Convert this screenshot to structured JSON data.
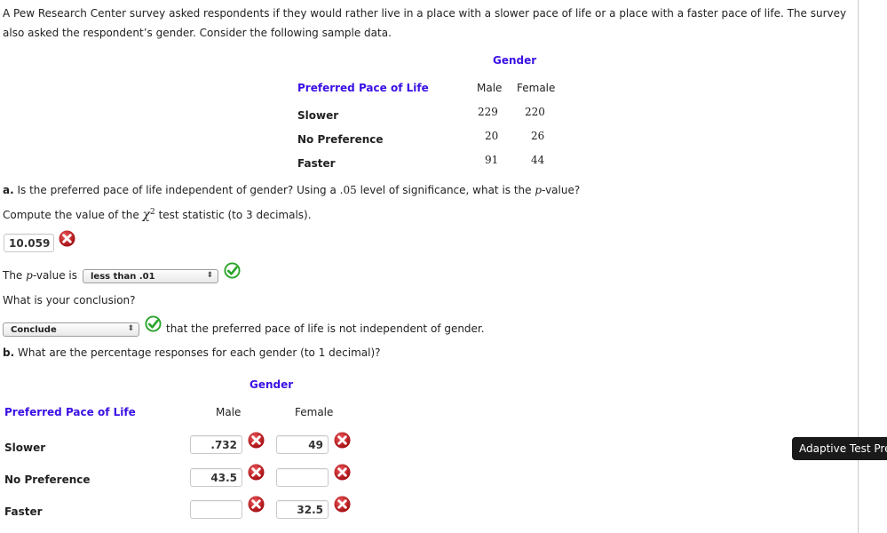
{
  "intro_text": "A Pew Research Center survey asked respondents if they would rather live in a place with a slower pace of life or a place with a faster pace of life. The survey also asked the respondent’s gender. Consider the following sample data.",
  "data_table": {
    "group_header": "Gender",
    "row_header": "Preferred Pace of Life",
    "columns": [
      "Male",
      "Female"
    ],
    "rows": [
      {
        "label": "Slower",
        "values": [
          "229",
          "220"
        ]
      },
      {
        "label": "No Preference",
        "values": [
          "20",
          "26"
        ]
      },
      {
        "label": "Faster",
        "values": [
          "91",
          "44"
        ]
      }
    ]
  },
  "part_a": {
    "prefix": "a.",
    "question_pre": " Is the preferred pace of life independent of gender? Using a ",
    "significance": ".05",
    "question_mid": " level of significance, what is the ",
    "p_symbol": "p",
    "question_post": "-value?",
    "compute_pre": "Compute the value of the ",
    "chi_symbol": "χ",
    "chi_exp": "2",
    "compute_post": " test statistic (to 3 decimals).",
    "chi_value": "10.059",
    "chi_status": "incorrect",
    "pvalue_pre": "The ",
    "pvalue_p": "p",
    "pvalue_post": "-value is",
    "pvalue_selected": "less than .01",
    "pvalue_status": "correct",
    "conclusion_question": "What is your conclusion?",
    "conclusion_selected": "Conclude",
    "conclusion_status": "correct",
    "conclusion_text": "that the preferred pace of life is not independent of gender."
  },
  "part_b": {
    "prefix": "b.",
    "question": " What are the percentage responses for each gender (to 1 decimal)?",
    "group_header": "Gender",
    "row_header": "Preferred Pace of Life",
    "columns": [
      "Male",
      "Female"
    ],
    "rows": [
      {
        "label": "Slower",
        "male": ".732",
        "female": "49",
        "male_status": "incorrect",
        "female_status": "incorrect"
      },
      {
        "label": "No Preference",
        "male": "43.5",
        "female": "",
        "male_status": "incorrect",
        "female_status": "incorrect"
      },
      {
        "label": "Faster",
        "male": "",
        "female": "32.5",
        "male_status": "incorrect",
        "female_status": "incorrect"
      }
    ]
  },
  "tooltip": "Adaptive Test Prep",
  "colors": {
    "header_blue": "#3a10e5",
    "correct_green": "#2aa52a",
    "incorrect_red": "#c8161d"
  }
}
